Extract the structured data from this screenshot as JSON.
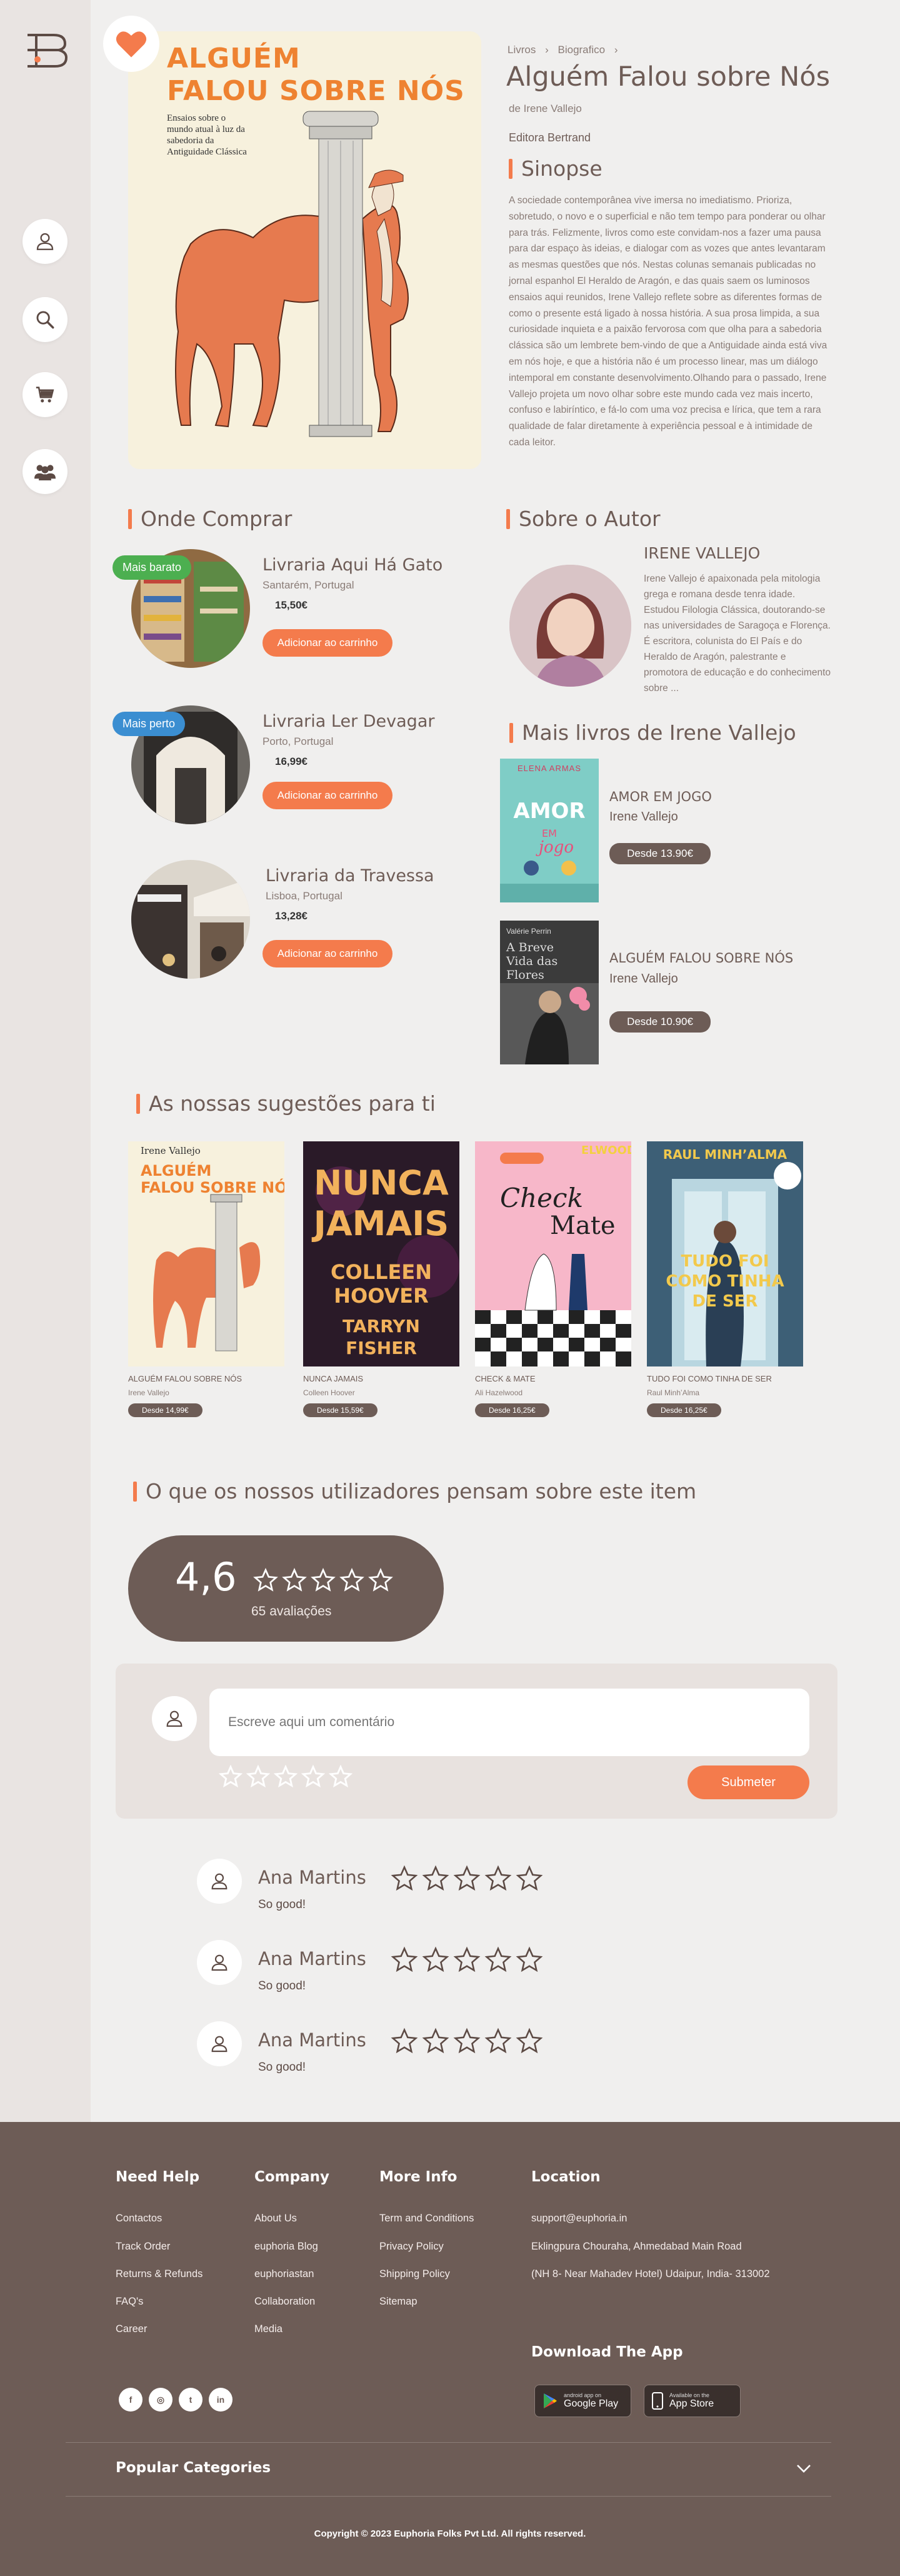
{
  "sidebar": {
    "nav": [
      "user-icon",
      "search-icon",
      "cart-icon",
      "community-icon"
    ]
  },
  "book": {
    "cover_title_line1": "ALGUÉM",
    "cover_title_line2": "FALOU SOBRE NÓS",
    "cover_subtitle": "Ensaios sobre o mundo atual à luz da sabedoria da Antiguidade Clássica",
    "breadcrumb": [
      "Livros",
      "Biografico"
    ],
    "title": "Alguém Falou sobre Nós",
    "author_line": "de Irene Vallejo",
    "publisher": "Editora Bertrand",
    "synopsis_heading": "Sinopse",
    "synopsis": "A sociedade contemporânea vive imersa no imediatismo. Prioriza, sobretudo, o novo e o superficial e não tem tempo para ponderar ou olhar para trás. Felizmente, livros como este convidam-nos a fazer uma pausa para dar espaço às ideias, e dialogar com as vozes que antes levantaram as mesmas questões que nós. Nestas colunas semanais publicadas no jornal espanhol El Heraldo de Aragón, e das quais saem os luminosos ensaios aqui reunidos, Irene Vallejo reflete sobre as diferentes formas de como o presente está ligado à nossa história. A sua prosa limpida, a sua curiosidade inquieta e a paixão fervorosa com que olha para a sabedoria clássica são um lembrete bem-vindo de que a Antiguidade ainda está viva em nós hoje, e que a história não é um processo linear, mas um diálogo intemporal em constante desenvolvimento.Olhando para o passado, Irene Vallejo projeta um novo olhar sobre este mundo cada vez mais incerto, confuso e labiríntico, e fá-lo com uma voz precisa e lírica, que tem a rara qualidade de falar diretamente à experiência pessoal e à intimidade de cada leitor."
  },
  "where_to_buy": {
    "heading": "Onde Comprar",
    "stores": [
      {
        "badge": "Mais barato",
        "badge_color": "#4caf50",
        "name": "Livraria Aqui Há Gato",
        "location": "Santarém, Portugal",
        "price": "15,50€",
        "button": "Adicionar ao carrinho"
      },
      {
        "badge": "Mais perto",
        "badge_color": "#3b8ed1",
        "name": "Livraria Ler Devagar",
        "location": "Porto, Portugal",
        "price": "16,99€",
        "button": "Adicionar ao carrinho"
      },
      {
        "badge": "",
        "badge_color": "",
        "name": "Livraria da Travessa",
        "location": "Lisboa, Portugal",
        "price": "13,28€",
        "button": "Adicionar ao carrinho"
      }
    ]
  },
  "about_author": {
    "heading": "Sobre o Autor",
    "name": "IRENE VALLEJO",
    "bio": "Irene Vallejo é apaixonada pela mitologia grega e romana desde tenra idade. Estudou Filologia Clássica, doutorando-se nas universidades de Saragoça e Florença. É escritora, colunista do El País e do Heraldo de Aragón, palestrante e promotora de educação e do conhecimento sobre ..."
  },
  "more_books": {
    "heading": "Mais livros de Irene Vallejo",
    "items": [
      {
        "cover_author": "ELENA ARMAS",
        "cover_title": "AMOR EN JOGO",
        "title": "AMOR EM JOGO",
        "author": "Irene Vallejo",
        "button": "Desde 13.90€"
      },
      {
        "cover_author": "Valérie Perrin",
        "cover_title": "A Breve Vida das Flores",
        "title": "ALGUÉM FALOU SOBRE NÓS",
        "author": "Irene Vallejo",
        "button": "Desde 10.90€"
      }
    ]
  },
  "suggestions": {
    "heading": "As nossas sugestões para ti",
    "items": [
      {
        "title": "ALGUÉM FALOU SOBRE NÓS",
        "author": "Irene Vallejo",
        "button": "Desde 14,99€"
      },
      {
        "title": "NUNCA JAMAIS",
        "author": "Colleen Hoover",
        "button": "Desde 15,59€"
      },
      {
        "title": "CHECK & MATE",
        "author": "Ali Hazelwood",
        "button": "Desde 16,25€"
      },
      {
        "title": "TUDO FOI COMO TINHA DE SER",
        "author": "Raul MinhʼAlma",
        "button": "Desde 16,25€"
      }
    ]
  },
  "reviews": {
    "heading": "O que os nossos utilizadores pensam sobre este item",
    "rating": "4,6",
    "count": "65 avaliações",
    "comment_placeholder": "Escreve aqui um comentário",
    "submit": "Submeter",
    "list": [
      {
        "name": "Ana Martins",
        "text": "So good!"
      },
      {
        "name": "Ana Martins",
        "text": "So good!"
      },
      {
        "name": "Ana Martins",
        "text": "So good!"
      }
    ]
  },
  "footer": {
    "need_help": {
      "heading": "Need Help",
      "links": [
        "Contactos",
        "Track Order",
        "Returns & Refunds",
        "FAQ's",
        "Career"
      ]
    },
    "company": {
      "heading": "Company",
      "links": [
        "About Us",
        "euphoria Blog",
        "euphoriastan",
        "Collaboration",
        "Media"
      ]
    },
    "more_info": {
      "heading": "More Info",
      "links": [
        "Term and Conditions",
        "Privacy Policy",
        "Shipping Policy",
        "Sitemap"
      ]
    },
    "location": {
      "heading": "Location",
      "lines": [
        "support@euphoria.in",
        "Eklingpura Chouraha, Ahmedabad Main Road",
        "(NH 8- Near Mahadev Hotel) Udaipur, India- 313002"
      ]
    },
    "download": {
      "heading": "Download The App",
      "google_small": "android app on",
      "google": "Google Play",
      "apple_small": "Available on the",
      "apple": "App Store"
    },
    "social": [
      "f",
      "◎",
      "t",
      "in"
    ],
    "popular": "Popular Categories",
    "copyright": "Copyright © 2023 Euphoria Folks Pvt Ltd. All rights reserved."
  }
}
